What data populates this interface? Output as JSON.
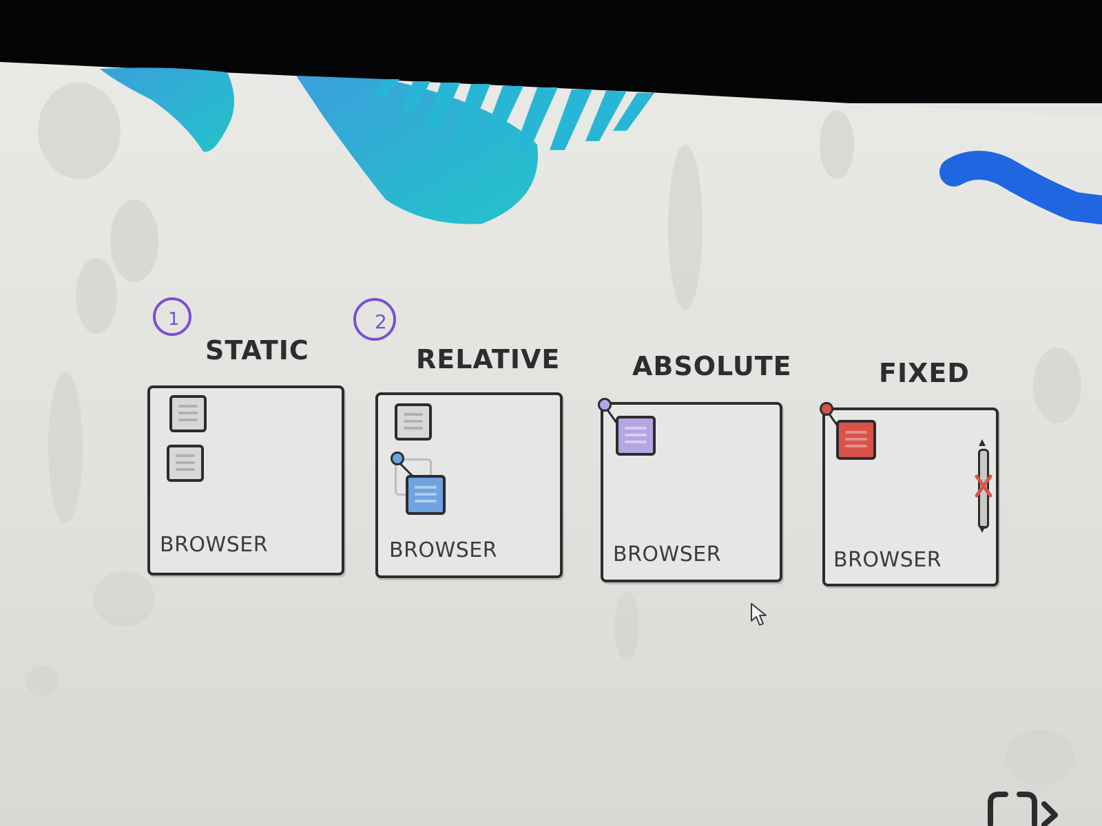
{
  "panels": [
    {
      "title": "STATIC",
      "label": "BROWSER",
      "annotation": "1"
    },
    {
      "title": "RELATIVE",
      "label": "BROWSER",
      "annotation": "2"
    },
    {
      "title": "ABSOLUTE",
      "label": "BROWSER"
    },
    {
      "title": "FIXED",
      "label": "BROWSER"
    }
  ],
  "colors": {
    "relative_box": "#6fa3e0",
    "absolute_box": "#b6a5e4",
    "fixed_box": "#d9534a",
    "annotation_ink": "#7a4fd0",
    "blob": "#2fa7d6"
  },
  "icons": [
    "mouse-pointer-icon",
    "brackets-icon"
  ]
}
